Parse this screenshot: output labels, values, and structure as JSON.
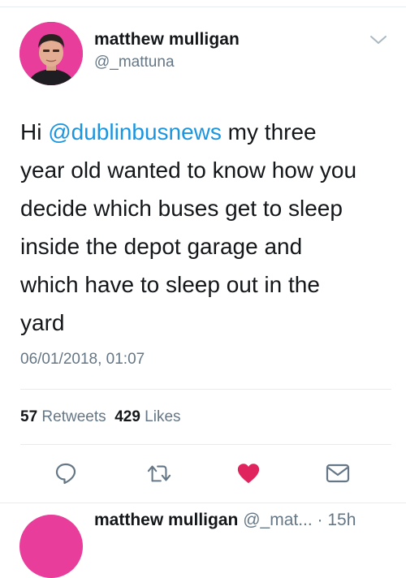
{
  "tweet": {
    "author": {
      "display_name": "matthew mulligan",
      "handle": "@_mattuna",
      "avatar_bg": "#e83d9a"
    },
    "menu_icon": "chevron-down-icon",
    "text_prefix": "Hi ",
    "mention": "@dublinbusnews",
    "text_body": " my three\nyear old wanted to know how you\ndecide which buses get to sleep\ninside the depot garage and\nwhich have to sleep out in the\nyard",
    "timestamp": "06/01/2018, 01:07",
    "stats": {
      "retweets_count": "57",
      "retweets_label": "Retweets",
      "likes_count": "429",
      "likes_label": "Likes"
    },
    "actions": [
      {
        "name": "reply-icon"
      },
      {
        "name": "retweet-icon"
      },
      {
        "name": "like-heart-icon",
        "active": true,
        "color": "#e0245e"
      },
      {
        "name": "direct-message-icon"
      }
    ]
  },
  "next_tweet": {
    "display_name": "matthew mulligan",
    "meta": "@_mat... · 15h"
  },
  "colors": {
    "link": "#1b95e0",
    "secondary_text": "#657786",
    "like_active": "#e0245e",
    "divider": "#e6ecf0"
  }
}
